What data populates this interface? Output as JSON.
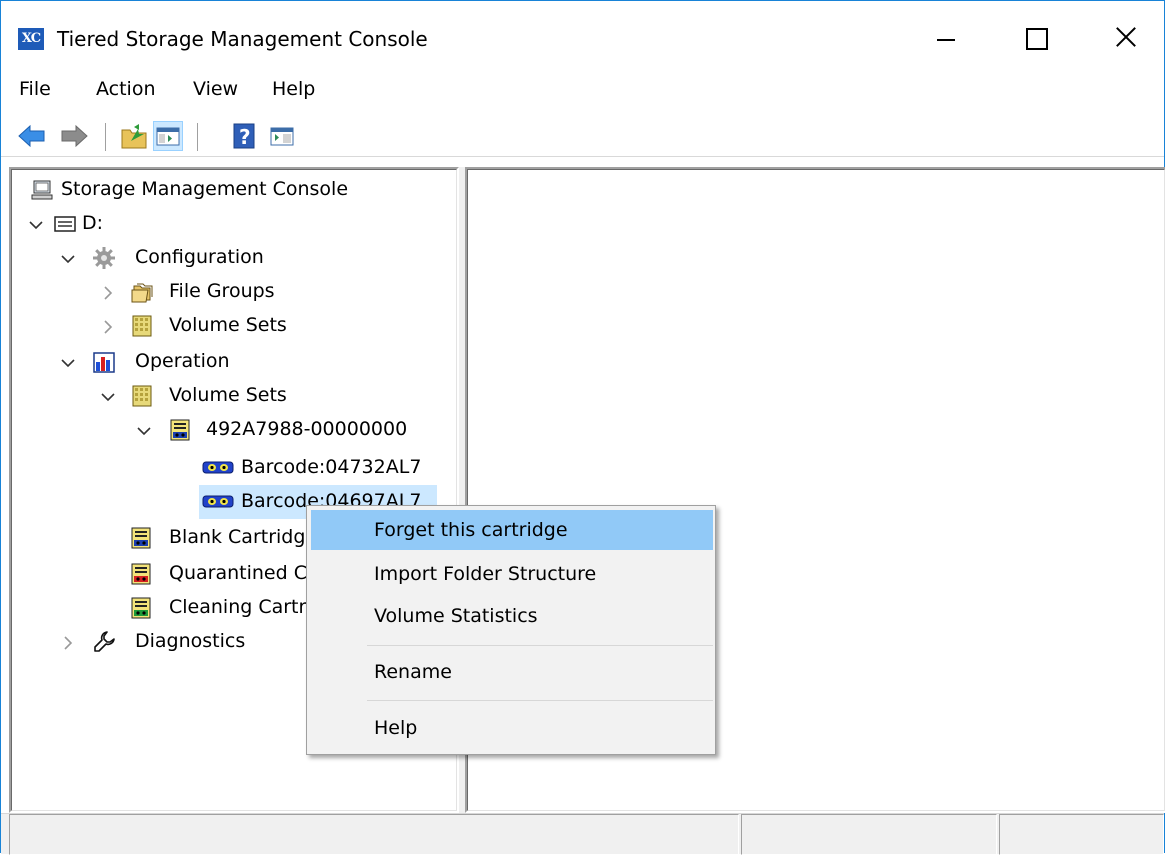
{
  "window": {
    "title": "Tiered Storage Management Console",
    "app_icon_text": "XC"
  },
  "menu": [
    "File",
    "Action",
    "View",
    "Help"
  ],
  "toolbar": {
    "icons": [
      "back-arrow-icon",
      "forward-arrow-icon",
      "up-folder-icon",
      "show-hide-tree-icon",
      "help-icon",
      "action-pane-icon"
    ]
  },
  "tree": {
    "root": "Storage Management Console",
    "drive": "D:",
    "configuration": "Configuration",
    "config_file_groups": "File Groups",
    "config_volume_sets": "Volume Sets",
    "operation": "Operation",
    "op_volume_sets": "Volume Sets",
    "volume_set": "492A7988-00000000",
    "barcode1": "Barcode:04732AL7",
    "barcode2": "Barcode:04697AL7",
    "blank_cartridges": "Blank Cartridges",
    "quarantined": "Quarantined Cartridges",
    "cleaning": "Cleaning Cartridges",
    "diagnostics": "Diagnostics"
  },
  "context_menu": {
    "items": [
      {
        "label": "Forget this cartridge"
      },
      {
        "label": "Import Folder Structure"
      },
      {
        "label": "Volume Statistics"
      },
      {
        "label": "Rename"
      },
      {
        "label": "Help"
      }
    ]
  },
  "colors": {
    "window_border": "#1883d7",
    "selection": "#cce8ff",
    "menu_highlight": "#91c9f7"
  }
}
